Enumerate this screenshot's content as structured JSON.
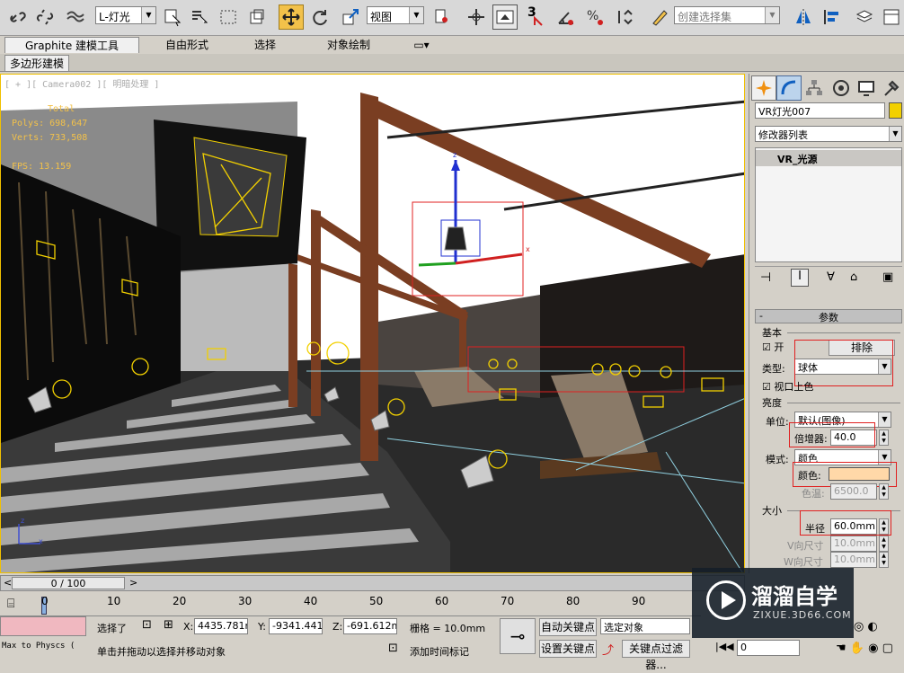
{
  "toolbar": {
    "selection_filter": "L-灯光",
    "ref_coord": "视图",
    "snap_3": "3",
    "named_selection_placeholder": "创建选择集"
  },
  "ribbon": {
    "tabs": [
      "Graphite 建模工具",
      "自由形式",
      "选择",
      "对象绘制"
    ],
    "subtab": "多边形建模"
  },
  "viewport": {
    "label": "[ + ][ Camera002 ][ 明暗处理 ]",
    "stats": {
      "total_label": "Total",
      "polys": "Polys: 698,647",
      "verts": "Verts: 733,508",
      "fps": "FPS:    13.159"
    },
    "axis_x": "x",
    "axis_y": "y",
    "axis_z": "z",
    "gizmo_z": "z",
    "gizmo_x": "x"
  },
  "panel": {
    "object_name": "VR灯光007",
    "modifier_list": "修改器列表",
    "stack_item": "VR_光源",
    "rollout_title": "参数",
    "basic_group": "基本",
    "on_label": "开",
    "exclude_button": "排除",
    "type_label": "类型:",
    "type_value": "球体",
    "viewport_color_label": "视口上色",
    "intensity_group": "亮度",
    "units_label": "单位:",
    "units_value": "默认(图像)",
    "multiplier_label": "倍增器:",
    "multiplier_value": "40.0",
    "mode_label": "模式:",
    "mode_value": "颜色",
    "color_label": "颜色:",
    "color_swatch": "#ffd8a8",
    "temp_label": "色温:",
    "temp_value": "6500.0",
    "size_group": "大小",
    "radius_label": "半径",
    "radius_value": "60.0mm",
    "v_size_label": "V向尺寸",
    "v_size_value": "10.0mm",
    "w_size_label": "W向尺寸",
    "w_size_value": "10.0mm"
  },
  "timeline": {
    "frame": "0 / 100",
    "ticks": [
      "0",
      "10",
      "20",
      "30",
      "40",
      "50",
      "60",
      "70",
      "80",
      "90"
    ]
  },
  "status": {
    "maxscript": "Max to Physcs (",
    "selected": "选择了",
    "x_label": "X:",
    "x_value": "4435.781m",
    "y_label": "Y:",
    "y_value": "-9341.441i",
    "z_label": "Z:",
    "z_value": "-691.612m",
    "grid": "栅格 = 10.0mm",
    "auto_key": "自动关键点",
    "selected_object": "选定对象",
    "set_key": "设置关键点",
    "key_filters": "关键点过滤器...",
    "prompt": "单击并拖动以选择并移动对象",
    "add_time_tag": "添加时间标记",
    "frame_field": "0"
  },
  "watermark": {
    "brand": "溜溜自学",
    "url": "ZIXUE.3D66.COM"
  }
}
